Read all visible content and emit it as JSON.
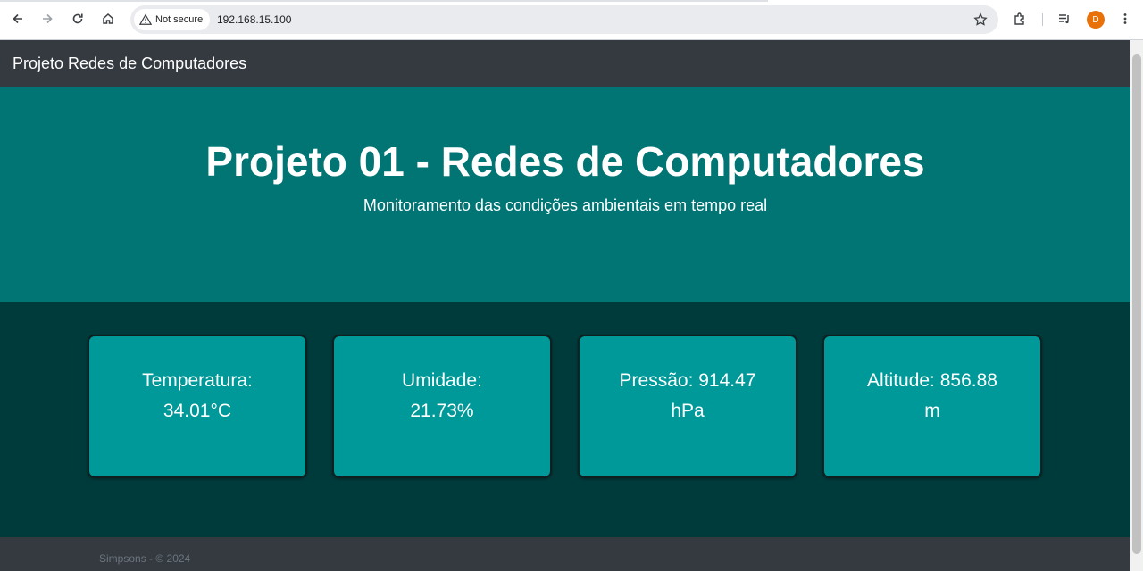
{
  "browser": {
    "security_label": "Not secure",
    "url": "192.168.15.100",
    "profile_initial": "D",
    "icons": [
      "back-icon",
      "forward-icon",
      "reload-icon",
      "home-icon",
      "warning-icon",
      "star-icon",
      "extensions-icon",
      "media-icon",
      "menu-icon"
    ]
  },
  "page": {
    "navbar": {
      "brand": "Projeto Redes de Computadores"
    },
    "hero": {
      "title": "Projeto 01 - Redes de Computadores",
      "subtitle": "Monitoramento das condições ambientais em tempo real"
    },
    "cards": [
      {
        "label": "Temperatura:",
        "value": "34.01°C"
      },
      {
        "label": "Umidade:",
        "value": "21.73%"
      },
      {
        "label": "Pressão: 914.47",
        "value": "hPa"
      },
      {
        "label": "Altitude: 856.88",
        "value": "m"
      }
    ],
    "footer": {
      "text": "Simpsons - © 2024"
    }
  },
  "colors": {
    "navbar": "#343a40",
    "hero": "#007574",
    "cards_section": "#003b3c",
    "card": "#009999",
    "avatar": "#e8710a"
  }
}
